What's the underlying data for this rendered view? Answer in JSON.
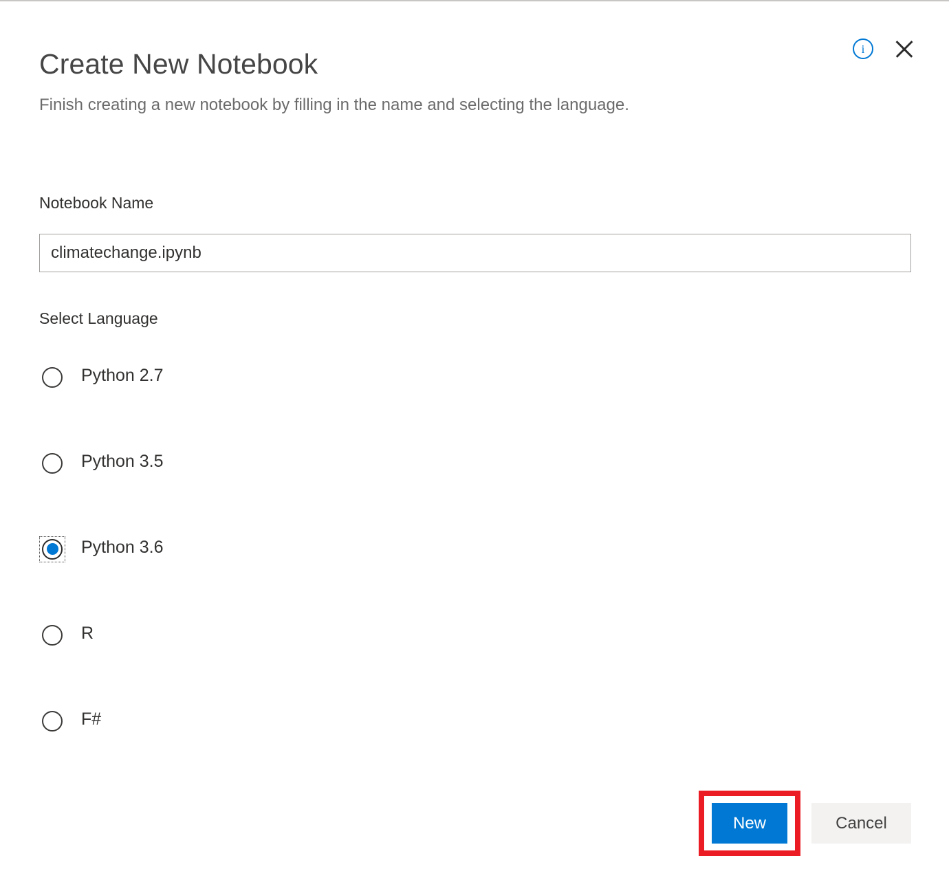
{
  "dialog": {
    "title": "Create New Notebook",
    "subtitle": "Finish creating a new notebook by filling in the name and selecting the language.",
    "info_icon": "info-circle-icon",
    "close_icon": "close-icon"
  },
  "form": {
    "name_label": "Notebook Name",
    "name_value": "climatechange.ipynb",
    "name_placeholder": "",
    "language_label": "Select Language",
    "languages": [
      {
        "label": "Python 2.7",
        "selected": false
      },
      {
        "label": "Python 3.5",
        "selected": false
      },
      {
        "label": "Python 3.6",
        "selected": true
      },
      {
        "label": "R",
        "selected": false
      },
      {
        "label": "F#",
        "selected": false
      }
    ]
  },
  "footer": {
    "primary_label": "New",
    "secondary_label": "Cancel"
  },
  "colors": {
    "accent": "#0078d4",
    "highlight": "#ec1c24",
    "secondary_button_bg": "#f3f2f1",
    "input_border": "#a19f9d",
    "subtitle_text": "#6b6b6b"
  }
}
